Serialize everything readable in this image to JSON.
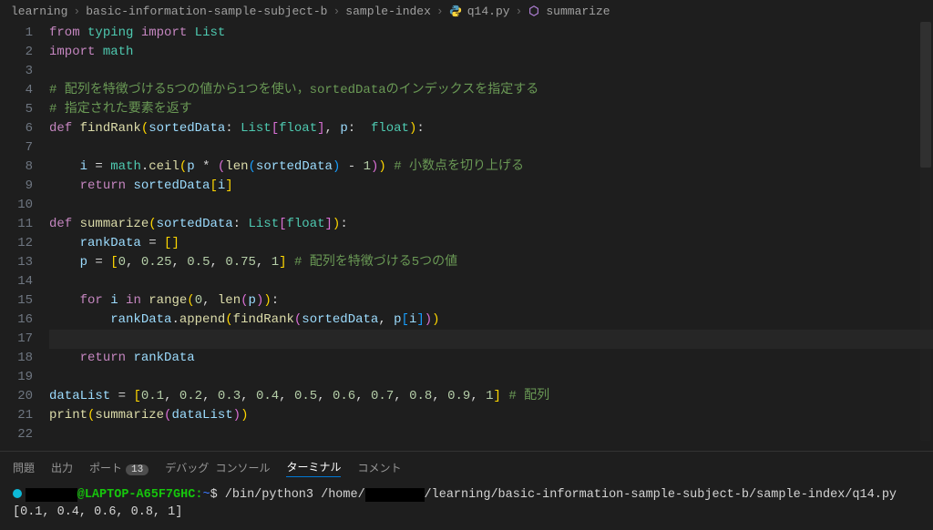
{
  "breadcrumb": {
    "seg0": "learning",
    "seg1": "basic-information-sample-subject-b",
    "seg2": "sample-index",
    "seg3": "q14.py",
    "seg4": "summarize"
  },
  "lineNumbers": [
    "1",
    "2",
    "3",
    "4",
    "5",
    "6",
    "7",
    "8",
    "9",
    "10",
    "11",
    "12",
    "13",
    "14",
    "15",
    "16",
    "17",
    "18",
    "19",
    "20",
    "21",
    "22"
  ],
  "code": {
    "l1": {
      "kw1": "from",
      "mod1": "typing",
      "kw2": "import",
      "type1": "List"
    },
    "l2": {
      "kw1": "import",
      "mod1": "math"
    },
    "l4": {
      "cmt": "# 配列を特徴づける5つの値から1つを使い，sortedDataのインデックスを指定する"
    },
    "l5": {
      "cmt": "# 指定された要素を返す"
    },
    "l6": {
      "kw": "def",
      "fn": "findRank",
      "p1": "sortedData",
      "t1": "List",
      "t2": "float",
      "p2": "p",
      "t3": "float"
    },
    "l8": {
      "v": "i",
      "mod": "math",
      "fn": "ceil",
      "p": "p",
      "fn2": "len",
      "arg": "sortedData",
      "num": "1",
      "cmt": "# 小数点を切り上げる"
    },
    "l9": {
      "kw": "return",
      "v": "sortedData",
      "idx": "i"
    },
    "l11": {
      "kw": "def",
      "fn": "summarize",
      "p1": "sortedData",
      "t1": "List",
      "t2": "float"
    },
    "l12": {
      "v": "rankData"
    },
    "l13": {
      "v": "p",
      "n0": "0",
      "n1": "0.25",
      "n2": "0.5",
      "n3": "0.75",
      "n4": "1",
      "cmt": "# 配列を特徴づける5つの値"
    },
    "l15": {
      "kw1": "for",
      "v": "i",
      "kw2": "in",
      "fn": "range",
      "n0": "0",
      "fn2": "len",
      "arg": "p"
    },
    "l16": {
      "v": "rankData",
      "fn": "append",
      "fn2": "findRank",
      "a1": "sortedData",
      "a2": "p",
      "idx": "i"
    },
    "l18": {
      "kw": "return",
      "v": "rankData"
    },
    "l20": {
      "v": "dataList",
      "n0": "0.1",
      "n1": "0.2",
      "n2": "0.3",
      "n3": "0.4",
      "n4": "0.5",
      "n5": "0.6",
      "n6": "0.7",
      "n7": "0.8",
      "n8": "0.9",
      "n9": "1",
      "cmt": "# 配列"
    },
    "l21": {
      "fn1": "print",
      "fn2": "summarize",
      "arg": "dataList"
    }
  },
  "panel": {
    "tabs": {
      "problems": "問題",
      "output": "出力",
      "ports": "ポート",
      "portsBadge": "13",
      "debug": "デバッグ コンソール",
      "terminal": "ターミナル",
      "comments": "コメント"
    }
  },
  "terminal": {
    "host": "@LAPTOP-A65F7GHC",
    "promptTail": ":",
    "tilde": "~",
    "dollar": "$",
    "cmd1": "/bin/python3",
    "cmd2a": "/home/",
    "cmd2b": "/learning/basic-information-sample-subject-b/sample-index/q14.py",
    "output": "[0.1, 0.4, 0.6, 0.8, 1]"
  }
}
